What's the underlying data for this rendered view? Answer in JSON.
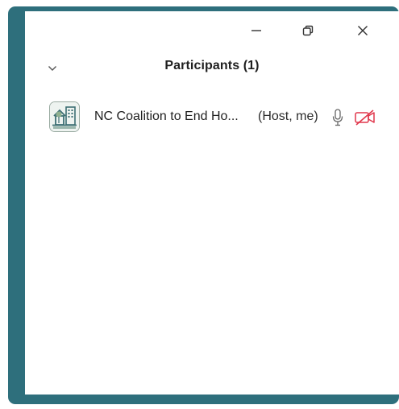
{
  "panel": {
    "title": "Participants (1)"
  },
  "participants": [
    {
      "name": "NC Coalition to End Ho...",
      "role": "(Host, me)",
      "avatar_icon": "organization-logo-icon",
      "mic_icon": "microphone-icon",
      "video_icon": "video-off-icon",
      "video_icon_color": "#e0364b"
    }
  ],
  "window_controls": {
    "minimize_icon": "minimize-icon",
    "restore_icon": "restore-icon",
    "close_icon": "close-icon"
  },
  "colors": {
    "frame": "#2e6f7c",
    "background": "#ffffff",
    "text": "#1f1f1f",
    "video_off": "#e0364b"
  }
}
